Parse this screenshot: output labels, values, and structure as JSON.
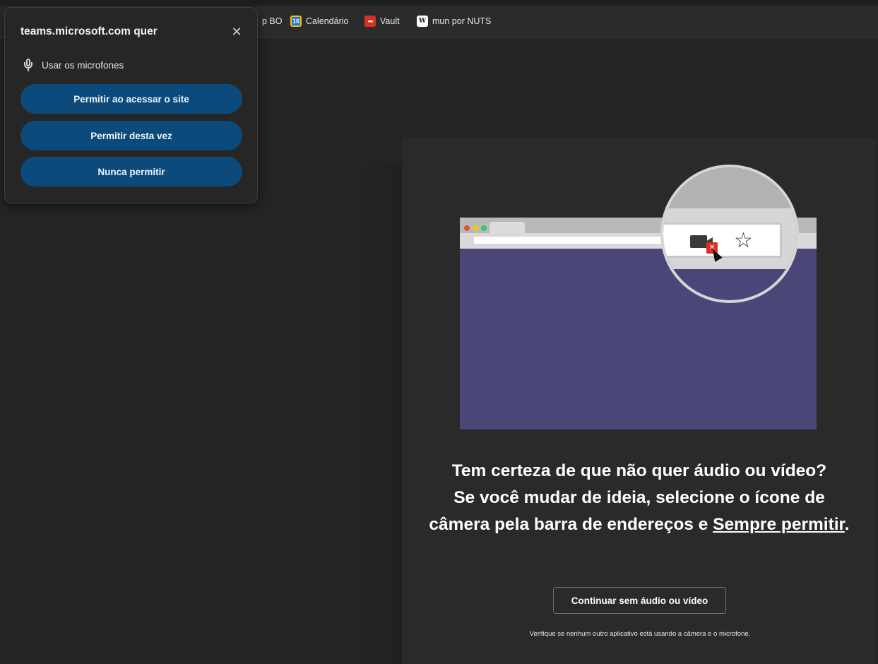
{
  "bookmarks": [
    {
      "label": "p BO",
      "icon": "none"
    },
    {
      "label": "Calendário",
      "icon": "calendar-icon",
      "badge": "16"
    },
    {
      "label": "Vault",
      "icon": "vault-icon",
      "badge": "•••"
    },
    {
      "label": "mun por NUTS",
      "icon": "wikipedia-icon",
      "badge": "W"
    }
  ],
  "popup": {
    "title": "teams.microsoft.com quer",
    "close_glyph": "✕",
    "permission": "Usar os microfones",
    "buttons": [
      "Permitir ao acessar o site",
      "Permitir desta vez",
      "Nunca permitir"
    ]
  },
  "main": {
    "message_line1": "Tem certeza de que não quer áudio ou vídeo?",
    "message_line2": "Se você mudar de ideia, selecione o ícone de câmera pela barra de endereços e",
    "message_link": "Sempre permitir",
    "message_end": ".",
    "continue_label": "Continuar sem áudio ou vídeo",
    "hint": "Verifique se nenhum outro aplicativo está usando a câmera e o microfone."
  },
  "illustration": {
    "camera_badge": "✕",
    "star_glyph": "☆"
  },
  "colors": {
    "popup_button": "#0b4a7a",
    "illustration_body": "#4a4677",
    "camera_block": "#d93025"
  }
}
